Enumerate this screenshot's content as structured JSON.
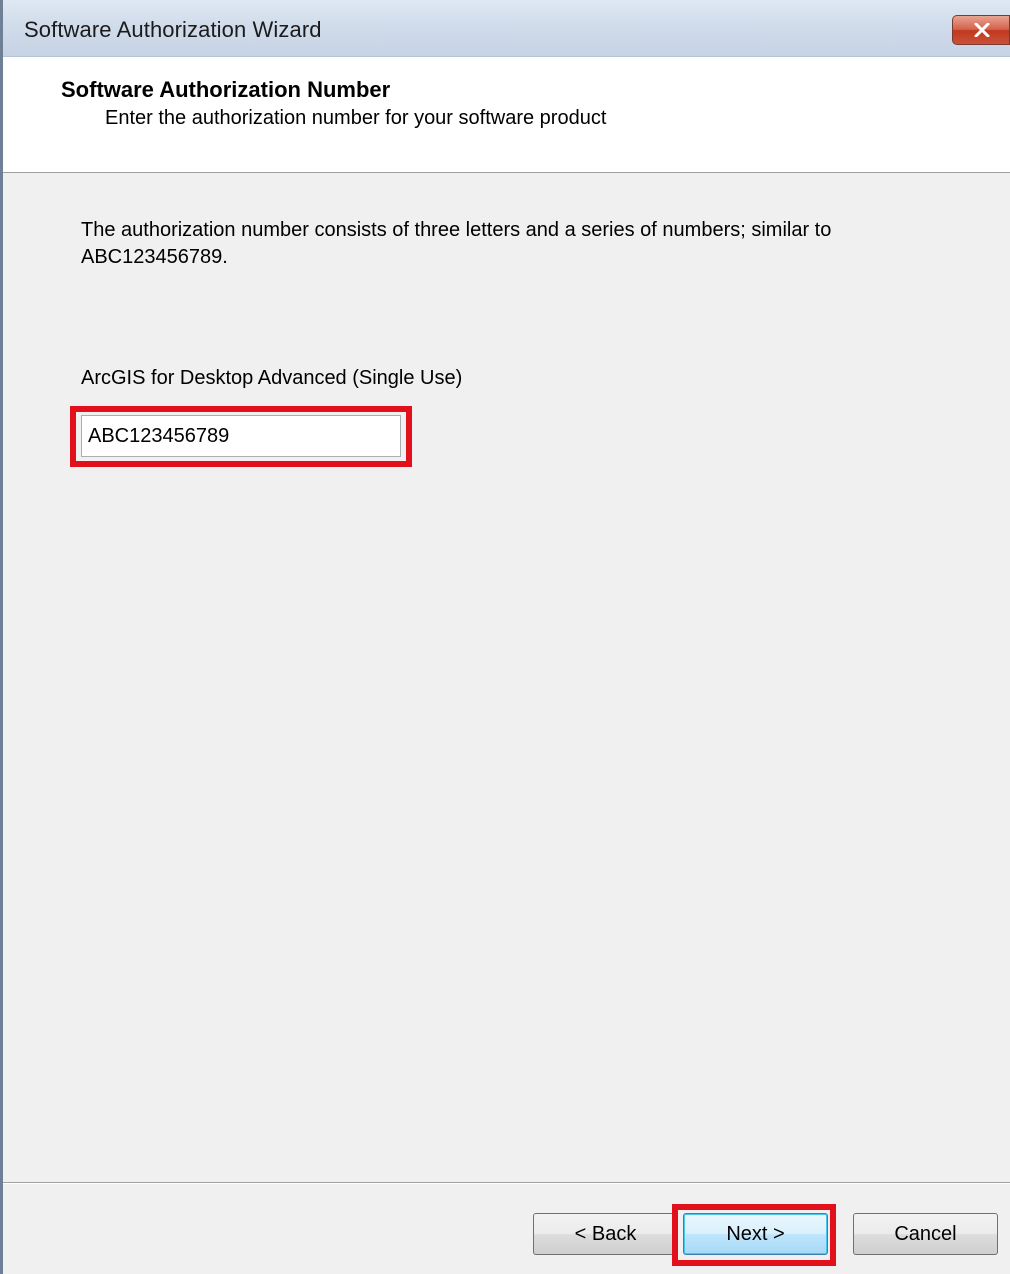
{
  "window": {
    "title": "Software Authorization Wizard"
  },
  "header": {
    "title": "Software Authorization Number",
    "subtitle": "Enter the authorization number for your software product"
  },
  "main": {
    "description": "The authorization number consists of three letters and a series of numbers; similar to ABC123456789.",
    "product_label": "ArcGIS for Desktop Advanced (Single Use)",
    "authorization_number": "ABC123456789"
  },
  "buttons": {
    "back": "< Back",
    "next": "Next >",
    "cancel": "Cancel"
  },
  "colors": {
    "highlight": "#e2101a",
    "dialog_background": "#f0f0f0"
  },
  "icons": {
    "close": "close-icon"
  }
}
